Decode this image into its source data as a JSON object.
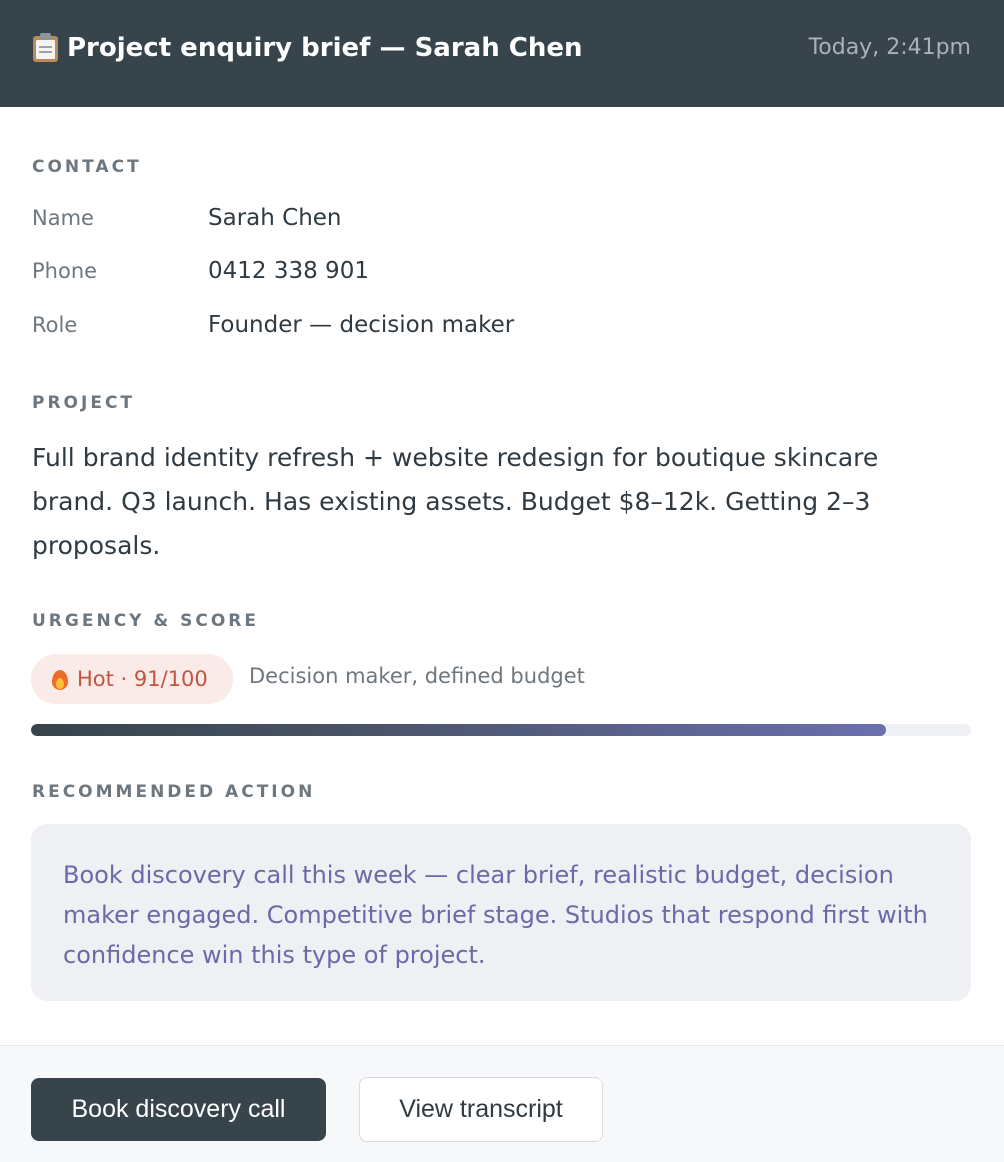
{
  "header": {
    "icon": "clipboard-icon",
    "title": "Project enquiry brief — Sarah Chen",
    "timestamp": "Today, 2:41pm"
  },
  "contact": {
    "section_label": "CONTACT",
    "fields": [
      {
        "label": "Name",
        "value": "Sarah Chen"
      },
      {
        "label": "Phone",
        "value": "0412 338 901"
      },
      {
        "label": "Role",
        "value": "Founder — decision maker"
      }
    ]
  },
  "project": {
    "section_label": "PROJECT",
    "description": "Full brand identity refresh + website redesign for boutique skincare brand. Q3 launch. Has existing assets. Budget $8–12k. Getting 2–3 proposals."
  },
  "urgency": {
    "section_label": "URGENCY & SCORE",
    "badge_icon": "fire-icon",
    "badge_text": "Hot · 91/100",
    "score": 91,
    "score_max": 100,
    "reason": "Decision maker, defined budget"
  },
  "recommendation": {
    "section_label": "RECOMMENDED ACTION",
    "text": "Book discovery call this week — clear brief, realistic budget, decision maker engaged. Competitive brief stage. Studios that respond first with confidence win this type of project."
  },
  "actions": {
    "primary_label": "Book discovery call",
    "secondary_label": "View transcript"
  },
  "colors": {
    "header_bg": "#37444c",
    "hot_badge_bg": "#fbebe8",
    "hot_badge_text": "#c1553f",
    "recommendation_text": "#6a6aa8"
  }
}
